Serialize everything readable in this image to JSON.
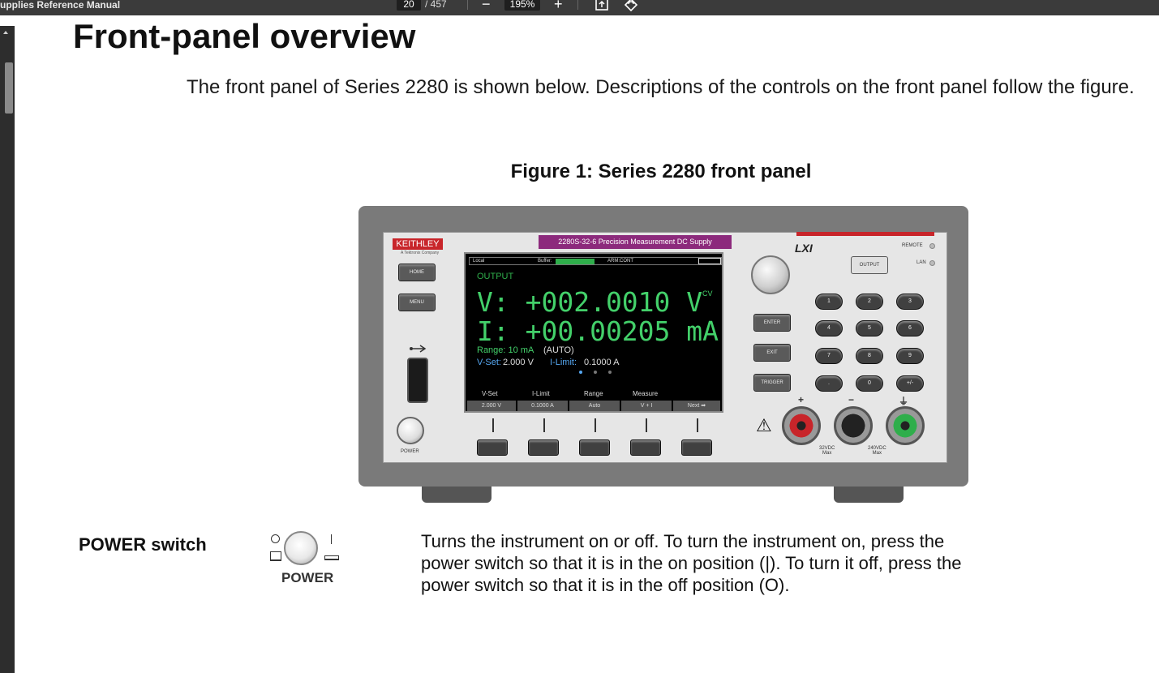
{
  "toolbar": {
    "doc_title": "upplies Reference Manual",
    "current_page": "20",
    "total_pages": "/ 457",
    "zoom_out": "−",
    "zoom": "195%",
    "zoom_in": "+",
    "fit_icon": "fit-page-icon",
    "rotate_icon": "rotate-icon"
  },
  "page": {
    "heading": "Front-panel overview",
    "intro": "The front panel of Series 2280 is shown below. Descriptions of the controls on the front panel follow the figure.",
    "figure_caption": "Figure 1: Series 2280 front panel"
  },
  "instrument": {
    "brand": "KEITHLEY",
    "brand_sub": "A Tektronix Company",
    "model": "2280S-32-6 Precision Measurement DC Supply",
    "lxi": "LXI",
    "remote": "REMOTE",
    "lan": "LAN",
    "home": "HOME",
    "menu": "MENU",
    "power": "POWER",
    "output_btn": "OUTPUT",
    "enter": "ENTER",
    "exit": "EXIT",
    "trigger": "TRIGGER",
    "keypad": [
      "1",
      "2",
      "3",
      "4",
      "5",
      "6",
      "7",
      "8",
      "9",
      ".",
      "0",
      "+/-"
    ],
    "term_plus": "+",
    "term_minus": "−",
    "term_ground": "⏚",
    "max32": "32VDC\nMax",
    "max240": "240VDC\nMax",
    "screen": {
      "local": "Local",
      "buffer": "Buffer:",
      "arm": "ARM:CONT",
      "output": "OUTPUT",
      "voltage": "V: +002.0010 V",
      "current": "I: +00.00205 mA",
      "cv": "CV",
      "range_label": "Range: 10 mA",
      "range_auto": "(AUTO)",
      "vset_label": "V-Set:",
      "vset_value": "2.000 V",
      "ilimit_label": "I-Limit:",
      "ilimit_value": "0.1000 A",
      "tab_headers": [
        "V-Set",
        "I-Limit",
        "Range",
        "Measure"
      ],
      "tab_values": [
        "2.000 V",
        "0.1000 A",
        "Auto",
        "V + I",
        "Next ➡"
      ]
    }
  },
  "power_switch": {
    "label": "POWER switch",
    "icon_word": "POWER",
    "description": "Turns the instrument on or off. To turn the instrument on, press the power switch so that it is in the on position (|). To turn it off, press the power switch so that it is in the off position (O)."
  }
}
